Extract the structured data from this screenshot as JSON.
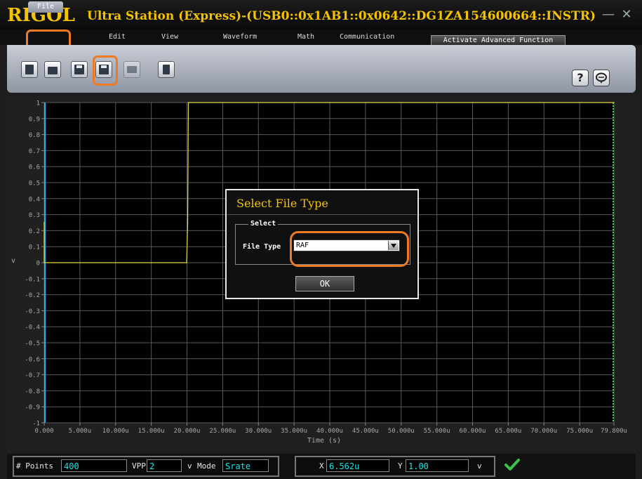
{
  "app": {
    "logo": "RIGOL",
    "window_title": "Ultra Station (Express)-(USB0::0x1AB1::0x0642::DG1ZA154600664::INSTR)",
    "minimize_glyph": "—",
    "close_glyph": "✕"
  },
  "menu": {
    "items": [
      "File",
      "Edit",
      "View",
      "Waveform",
      "Math",
      "Communication"
    ],
    "activate_button": "Activate Advanced Function"
  },
  "toolbar": {
    "icons": [
      "new-file-icon",
      "open-folder-icon",
      "save-icon",
      "save-as-icon",
      "print-icon",
      "import-icon"
    ],
    "help_label": "?",
    "help_icon": "question-mark-icon",
    "chat_icon": "speech-bubble-icon"
  },
  "chart_data": {
    "type": "line",
    "xlabel": "Time (s)",
    "ylabel": "v",
    "xlim": [
      0,
      79.8
    ],
    "ylim": [
      -1,
      1
    ],
    "x_unit": "u",
    "x_ticks": [
      "0.000",
      "5.000u",
      "10.000u",
      "15.000u",
      "20.000u",
      "25.000u",
      "30.000u",
      "35.000u",
      "40.000u",
      "45.000u",
      "50.000u",
      "55.000u",
      "60.000u",
      "65.000u",
      "70.000u",
      "75.000u",
      "79.800u"
    ],
    "x_tick_values": [
      0,
      5,
      10,
      15,
      20,
      25,
      30,
      35,
      40,
      45,
      50,
      55,
      60,
      65,
      70,
      75,
      79.8
    ],
    "y_ticks": [
      "1",
      "0.9",
      "0.8",
      "0.7",
      "0.6",
      "0.5",
      "0.4",
      "0.3",
      "0.2",
      "0.1",
      "0",
      "-0.1",
      "-0.2",
      "-0.3",
      "-0.4",
      "-0.5",
      "-0.6",
      "-0.7",
      "-0.8",
      "-0.9",
      "-1"
    ],
    "y_tick_values": [
      1,
      0.9,
      0.8,
      0.7,
      0.6,
      0.5,
      0.4,
      0.3,
      0.2,
      0.1,
      0,
      -0.1,
      -0.2,
      -0.3,
      -0.4,
      -0.5,
      -0.6,
      -0.7,
      -0.8,
      -0.9,
      -1
    ],
    "series": [
      {
        "x": [
          0,
          0,
          0.1,
          19.95,
          20.1,
          20.2,
          79.8
        ],
        "y": [
          0.25,
          0,
          0,
          0,
          0.25,
          1,
          1
        ]
      }
    ],
    "grid": true,
    "colors": {
      "trace": "#e3d63a",
      "left_marker": "#1ab5e8",
      "right_marker": "#3cd04a",
      "grid": "#5a5a5a",
      "background": "#000000"
    }
  },
  "dialog": {
    "title": "Select File Type",
    "group_label": "Select",
    "field_label": "File Type",
    "selected": "RAF",
    "ok_label": "OK"
  },
  "status": {
    "points_label": "# Points",
    "points_value": "400",
    "vpp_label": "VPP",
    "vpp_value": "2",
    "vpp_unit": "v",
    "mode_label": "Mode",
    "mode_value": "Srate",
    "x_label": "X",
    "x_value": "6.562u",
    "y_label": "Y",
    "y_value": "1.00",
    "y_unit": "v",
    "apply_icon": "checkmark-icon"
  },
  "colors": {
    "accent": "#f5c400",
    "highlight": "#f07a22",
    "value_text": "#16e7e7"
  }
}
